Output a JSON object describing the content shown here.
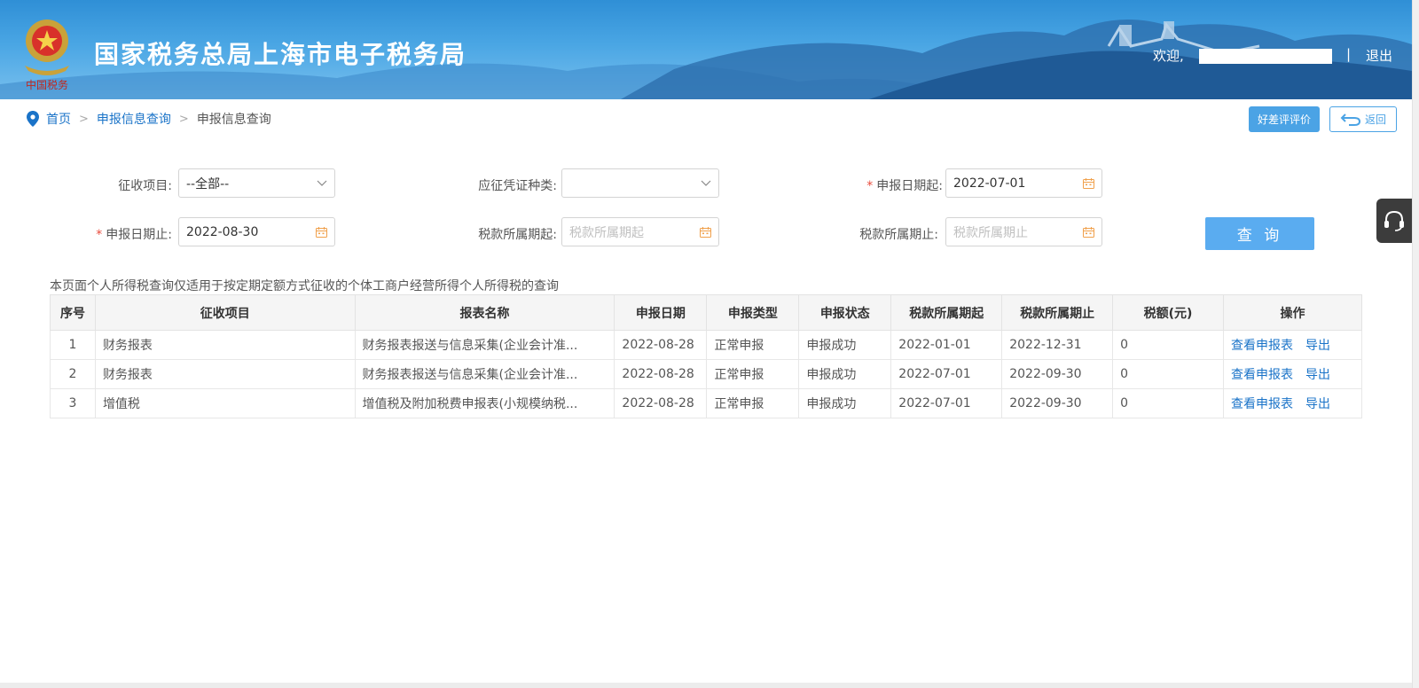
{
  "header": {
    "site_title": "国家税务总局上海市电子税务局",
    "emblem_caption": "中国税务",
    "welcome": "欢迎,",
    "separator": "|",
    "logout": "退出"
  },
  "breadcrumb": {
    "home": "首页",
    "level1": "申报信息查询",
    "current": "申报信息查询",
    "sep": ">"
  },
  "actions": {
    "rate": "好差评评价",
    "back": "返回"
  },
  "form": {
    "levy_item_label": "征收项目:",
    "levy_item_value": "--全部--",
    "voucher_type_label": "应征凭证种类:",
    "voucher_type_value": "",
    "declare_start_label": "申报日期起:",
    "declare_start_value": "2022-07-01",
    "declare_end_label": "申报日期止:",
    "declare_end_value": "2022-08-30",
    "tax_period_start_label": "税款所属期起:",
    "tax_period_start_placeholder": "税款所属期起",
    "tax_period_end_label": "税款所属期止:",
    "tax_period_end_placeholder": "税款所属期止",
    "required_mark": "*",
    "query_button": "查 询"
  },
  "notice": "本页面个人所得税查询仅适用于按定期定额方式征收的个体工商户经营所得个人所得税的查询",
  "table": {
    "headers": [
      "序号",
      "征收项目",
      "报表名称",
      "申报日期",
      "申报类型",
      "申报状态",
      "税款所属期起",
      "税款所属期止",
      "税额(元)",
      "操作"
    ],
    "rows": [
      {
        "no": "1",
        "item": "财务报表",
        "report": "财务报表报送与信息采集(企业会计准...",
        "date": "2022-08-28",
        "type": "正常申报",
        "status": "申报成功",
        "start": "2022-01-01",
        "end": "2022-12-31",
        "tax": "0",
        "view": "查看申报表",
        "export": "导出"
      },
      {
        "no": "2",
        "item": "财务报表",
        "report": "财务报表报送与信息采集(企业会计准...",
        "date": "2022-08-28",
        "type": "正常申报",
        "status": "申报成功",
        "start": "2022-07-01",
        "end": "2022-09-30",
        "tax": "0",
        "view": "查看申报表",
        "export": "导出"
      },
      {
        "no": "3",
        "item": "增值税",
        "report": "增值税及附加税费申报表(小规模纳税...",
        "date": "2022-08-28",
        "type": "正常申报",
        "status": "申报成功",
        "start": "2022-07-01",
        "end": "2022-09-30",
        "tax": "0",
        "view": "查看申报表",
        "export": "导出"
      }
    ]
  },
  "icons": {
    "location": "location-pin-icon",
    "calendar": "calendar-icon",
    "dropdown": "chevron-down-icon",
    "back": "return-arrow-icon",
    "service": "headset-icon"
  },
  "colors": {
    "link": "#1a73c8",
    "accent": "#4ba3e5",
    "query_button": "#5aacf0",
    "required": "#e94b3c",
    "calendar_icon": "#f0a04b"
  }
}
